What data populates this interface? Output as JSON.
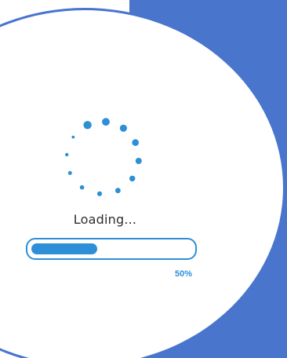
{
  "colors": {
    "panel": "#4a75cc",
    "accent": "#2d8fd6"
  },
  "loader": {
    "text": "Loading...",
    "progress": 0.5,
    "progress_label": "50%"
  }
}
